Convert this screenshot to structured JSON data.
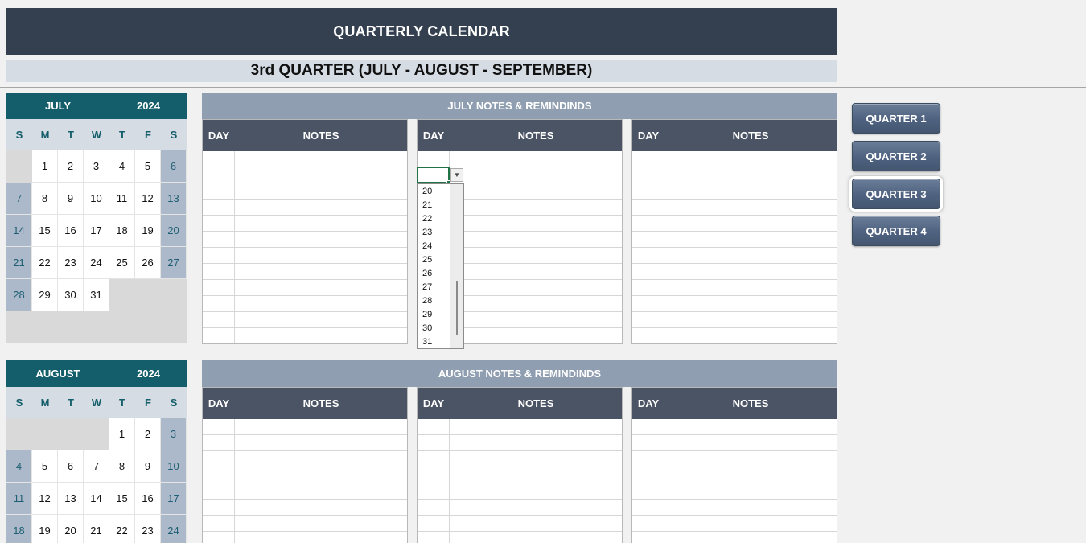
{
  "header": {
    "title": "QUARTERLY CALENDAR",
    "subtitle": "3rd QUARTER (JULY - AUGUST - SEPTEMBER)"
  },
  "days_of_week": [
    "S",
    "M",
    "T",
    "W",
    "T",
    "F",
    "S"
  ],
  "calendars": [
    {
      "month": "JULY",
      "year": "2024",
      "weeks": [
        [
          "",
          "1",
          "2",
          "3",
          "4",
          "5",
          "6"
        ],
        [
          "7",
          "8",
          "9",
          "10",
          "11",
          "12",
          "13"
        ],
        [
          "14",
          "15",
          "16",
          "17",
          "18",
          "19",
          "20"
        ],
        [
          "21",
          "22",
          "23",
          "24",
          "25",
          "26",
          "27"
        ],
        [
          "28",
          "29",
          "30",
          "31",
          "",
          "",
          ""
        ],
        [
          "",
          "",
          "",
          "",
          "",
          "",
          ""
        ]
      ]
    },
    {
      "month": "AUGUST",
      "year": "2024",
      "weeks": [
        [
          "",
          "",
          "",
          "",
          "1",
          "2",
          "3"
        ],
        [
          "4",
          "5",
          "6",
          "7",
          "8",
          "9",
          "10"
        ],
        [
          "11",
          "12",
          "13",
          "14",
          "15",
          "16",
          "17"
        ],
        [
          "18",
          "19",
          "20",
          "21",
          "22",
          "23",
          "24"
        ]
      ]
    }
  ],
  "notes_sections": [
    {
      "title": "JULY NOTES & REMINDINDS",
      "columns": [
        {
          "day": "DAY",
          "notes": "NOTES"
        },
        {
          "day": "DAY",
          "notes": "NOTES"
        },
        {
          "day": "DAY",
          "notes": "NOTES"
        }
      ]
    },
    {
      "title": "AUGUST NOTES & REMINDINDS",
      "columns": [
        {
          "day": "DAY",
          "notes": "NOTES"
        },
        {
          "day": "DAY",
          "notes": "NOTES"
        },
        {
          "day": "DAY",
          "notes": "NOTES"
        }
      ]
    }
  ],
  "quarter_buttons": [
    {
      "label": "QUARTER 1",
      "active": false
    },
    {
      "label": "QUARTER 2",
      "active": false
    },
    {
      "label": "QUARTER 3",
      "active": true
    },
    {
      "label": "QUARTER 4",
      "active": false
    }
  ],
  "dropdown": {
    "selected_value": "",
    "visible_options": [
      "20",
      "21",
      "22",
      "23",
      "24",
      "25",
      "26",
      "27",
      "28",
      "29",
      "30",
      "31"
    ],
    "arrow_icon": "chevron-down-icon"
  },
  "colors": {
    "title_bg": "#344050",
    "subtitle_bg": "#d6dce4",
    "calendar_header": "#135e6a",
    "weekend_cell": "#acb9ca",
    "notes_banner": "#8f9eb0",
    "notes_header": "#4a5464",
    "button": "#4e6280"
  }
}
